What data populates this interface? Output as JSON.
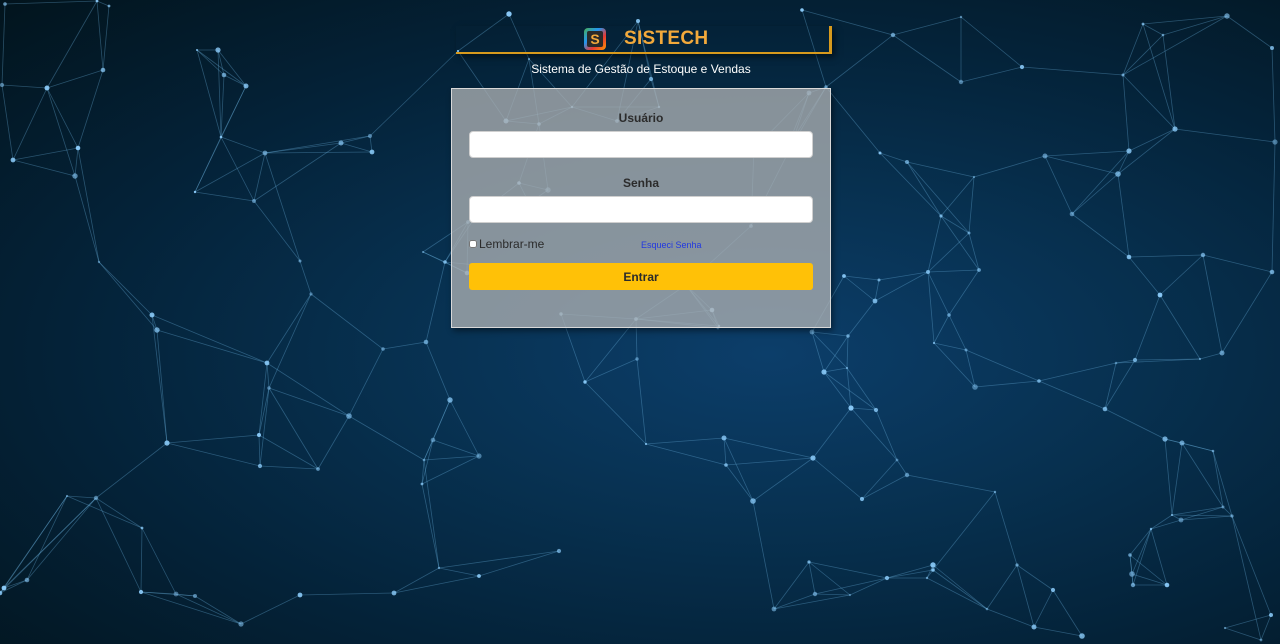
{
  "brand": {
    "name": "SISTECH",
    "logo_letter": "S",
    "subtitle": "Sistema de Gestão de Estoque e Vendas"
  },
  "form": {
    "user_label": "Usuário",
    "user_value": "",
    "password_label": "Senha",
    "password_value": "",
    "remember_label": "Lembrar-me",
    "remember_checked": false,
    "forgot_link": "Esqueci Senha",
    "submit_label": "Entrar"
  },
  "colors": {
    "accent": "#ffc107",
    "brand_text": "#f2a93b",
    "link": "#2238e0",
    "background_dark": "#02141d",
    "background_mid": "#0c3e6a"
  }
}
